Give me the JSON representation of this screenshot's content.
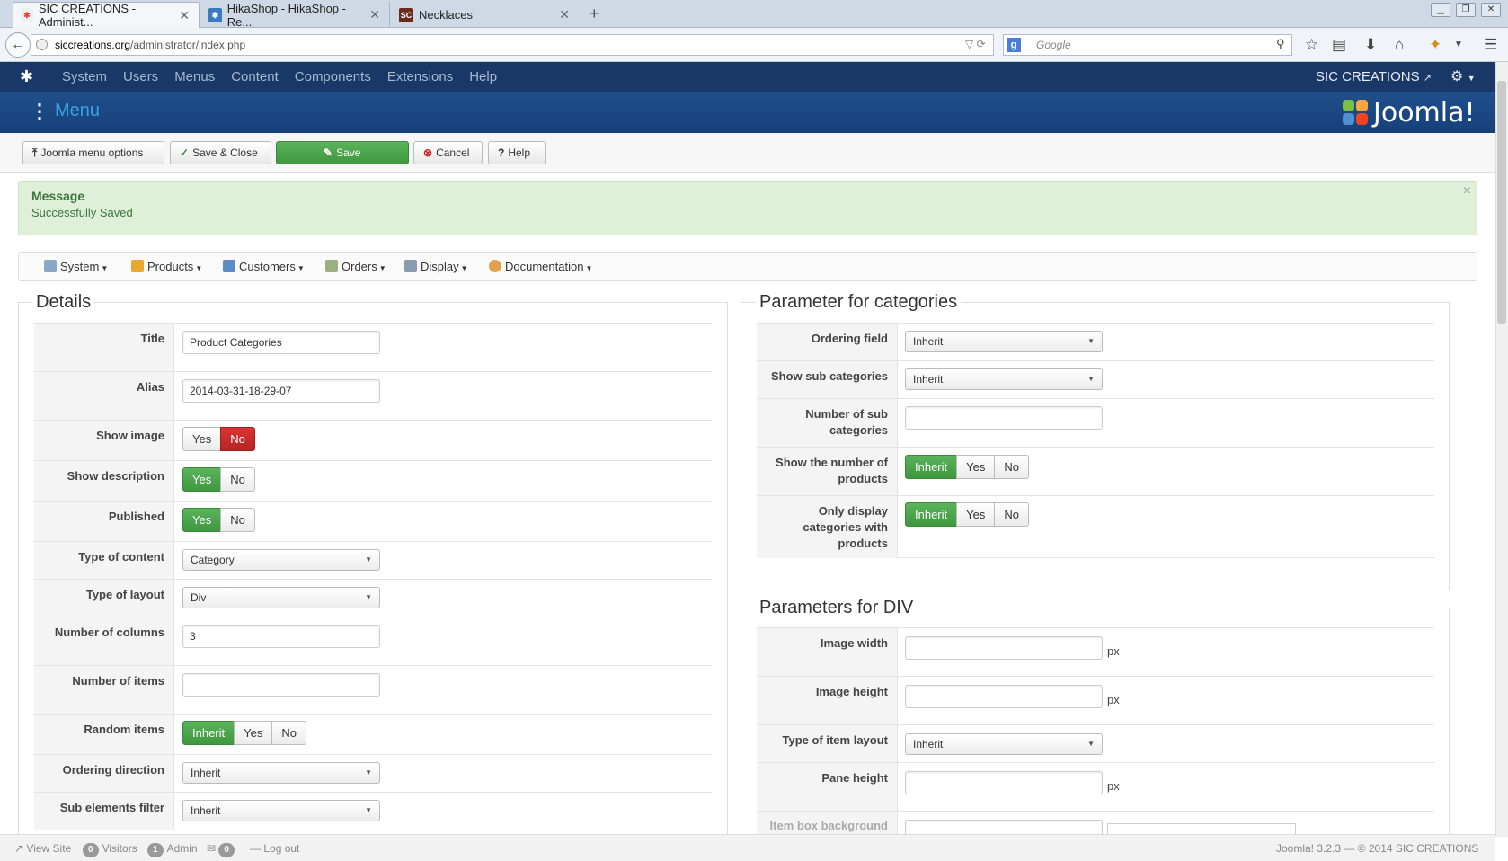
{
  "browser": {
    "tabs": [
      {
        "title": "SIC CREATIONS - Administ...",
        "icon": "joomla-favicon",
        "active": true
      },
      {
        "title": "HikaShop - HikaShop - Re...",
        "icon": "hikashop-favicon",
        "active": false
      },
      {
        "title": "Necklaces",
        "icon": "sc-favicon",
        "active": false
      }
    ],
    "url_host": "siccreations.org",
    "url_path": "/administrator/index.php",
    "search_placeholder": "Google"
  },
  "admin_bar": {
    "menu": [
      "System",
      "Users",
      "Menus",
      "Content",
      "Components",
      "Extensions",
      "Help"
    ],
    "site_name": "SIC CREATIONS",
    "brand": "Joomla!"
  },
  "header": {
    "title": "Menu"
  },
  "toolbar": {
    "menu_options": "Joomla menu options",
    "save_close": "Save & Close",
    "save": "Save",
    "cancel": "Cancel",
    "help": "Help"
  },
  "message": {
    "heading": "Message",
    "text": "Successfully Saved"
  },
  "hikamenu": [
    "System",
    "Products",
    "Customers",
    "Orders",
    "Display",
    "Documentation"
  ],
  "details": {
    "legend": "Details",
    "title_label": "Title",
    "title_value": "Product Categories",
    "alias_label": "Alias",
    "alias_value": "2014-03-31-18-29-07",
    "show_image_label": "Show image",
    "show_description_label": "Show description",
    "published_label": "Published",
    "type_content_label": "Type of content",
    "type_content_value": "Category",
    "type_layout_label": "Type of layout",
    "type_layout_value": "Div",
    "num_columns_label": "Number of columns",
    "num_columns_value": "3",
    "num_items_label": "Number of items",
    "num_items_value": "",
    "random_items_label": "Random items",
    "ordering_dir_label": "Ordering direction",
    "ordering_dir_value": "Inherit",
    "sub_filter_label": "Sub elements filter",
    "sub_filter_value": "Inherit"
  },
  "options": {
    "yes": "Yes",
    "no": "No",
    "inherit": "Inherit"
  },
  "categories": {
    "legend": "Parameter for categories",
    "ordering_field_label": "Ordering field",
    "ordering_field_value": "Inherit",
    "show_sub_label": "Show sub categories",
    "show_sub_value": "Inherit",
    "num_sub_label": "Number of sub categories",
    "num_sub_value": "",
    "show_num_products_label": "Show the number of products",
    "only_display_label": "Only display categories with products"
  },
  "div": {
    "legend": "Parameters for DIV",
    "image_width_label": "Image width",
    "image_height_label": "Image height",
    "item_layout_label": "Type of item layout",
    "item_layout_value": "Inherit",
    "pane_height_label": "Pane height",
    "item_box_bg_label": "Item box background",
    "unit": "px"
  },
  "status": {
    "view_site": "View Site",
    "visitors_count": "0",
    "visitors": "Visitors",
    "admin_count": "1",
    "admin": "Admin",
    "messages_count": "0",
    "logout": "Log out",
    "version": "Joomla! 3.2.3 — © 2014 SIC CREATIONS"
  }
}
